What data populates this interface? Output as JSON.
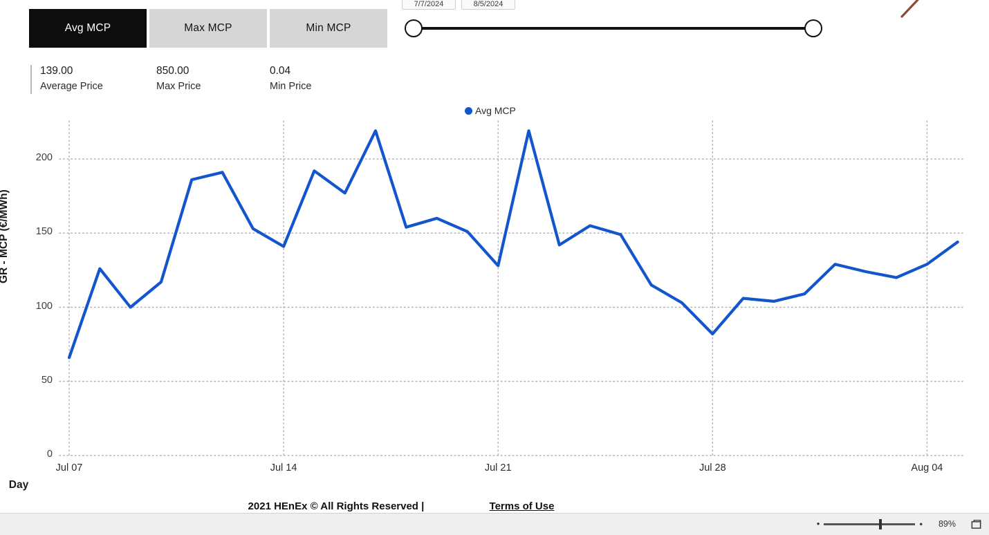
{
  "tabs": [
    {
      "label": "Avg MCP",
      "active": true
    },
    {
      "label": "Max MCP",
      "active": false
    },
    {
      "label": "Min MCP",
      "active": false
    }
  ],
  "date_range": {
    "from": "7/7/2024",
    "to": "8/5/2024",
    "slider_left_handle": "range-start-handle",
    "slider_right_handle": "range-end-handle"
  },
  "kpis": [
    {
      "value": "139.00",
      "label": "Average Price"
    },
    {
      "value": "850.00",
      "label": "Max Price"
    },
    {
      "value": "0.04",
      "label": "Min Price"
    }
  ],
  "footer": {
    "text": "2021 HEnEx © All Rights Reserved | ",
    "link": "Terms of Use"
  },
  "statusbar": {
    "zoom_level": "89%",
    "minus": "•",
    "plus": "⬩",
    "restore_icon": "restore-window-icon"
  },
  "colors": {
    "series": "#1255cc",
    "active_tab_bg": "#0d0d0d",
    "tab_bg": "#d6d6d6",
    "grid": "#b0b0b0"
  },
  "chart_data": {
    "type": "line",
    "title": "",
    "xlabel": "Day",
    "ylabel": "GR - MCP (€/MWh)",
    "legend": [
      "Avg MCP"
    ],
    "legend_position": "top-center",
    "grid": true,
    "ylim": [
      0,
      225
    ],
    "yticks": [
      0,
      50,
      100,
      150,
      200
    ],
    "ytick_labels": [
      "0",
      "50",
      "100",
      "150",
      "200"
    ],
    "xticks": [
      "Jul 07",
      "Jul 14",
      "Jul 21",
      "Jul 28",
      "Aug 04"
    ],
    "xtick_indices": [
      0,
      7,
      14,
      21,
      28
    ],
    "x": [
      "Jul 07",
      "Jul 08",
      "Jul 09",
      "Jul 10",
      "Jul 11",
      "Jul 12",
      "Jul 13",
      "Jul 14",
      "Jul 15",
      "Jul 16",
      "Jul 17",
      "Jul 18",
      "Jul 19",
      "Jul 20",
      "Jul 21",
      "Jul 22",
      "Jul 23",
      "Jul 24",
      "Jul 25",
      "Jul 26",
      "Jul 27",
      "Jul 28",
      "Jul 29",
      "Jul 30",
      "Jul 31",
      "Aug 01",
      "Aug 02",
      "Aug 03",
      "Aug 04",
      "Aug 05"
    ],
    "series": [
      {
        "name": "Avg MCP",
        "color": "#1255cc",
        "values": [
          66,
          126,
          100,
          117,
          186,
          191,
          153,
          141,
          192,
          177,
          219,
          154,
          160,
          151,
          128,
          219,
          142,
          155,
          149,
          115,
          103,
          82,
          106,
          104,
          109,
          129,
          124,
          120,
          129,
          144
        ]
      }
    ]
  }
}
